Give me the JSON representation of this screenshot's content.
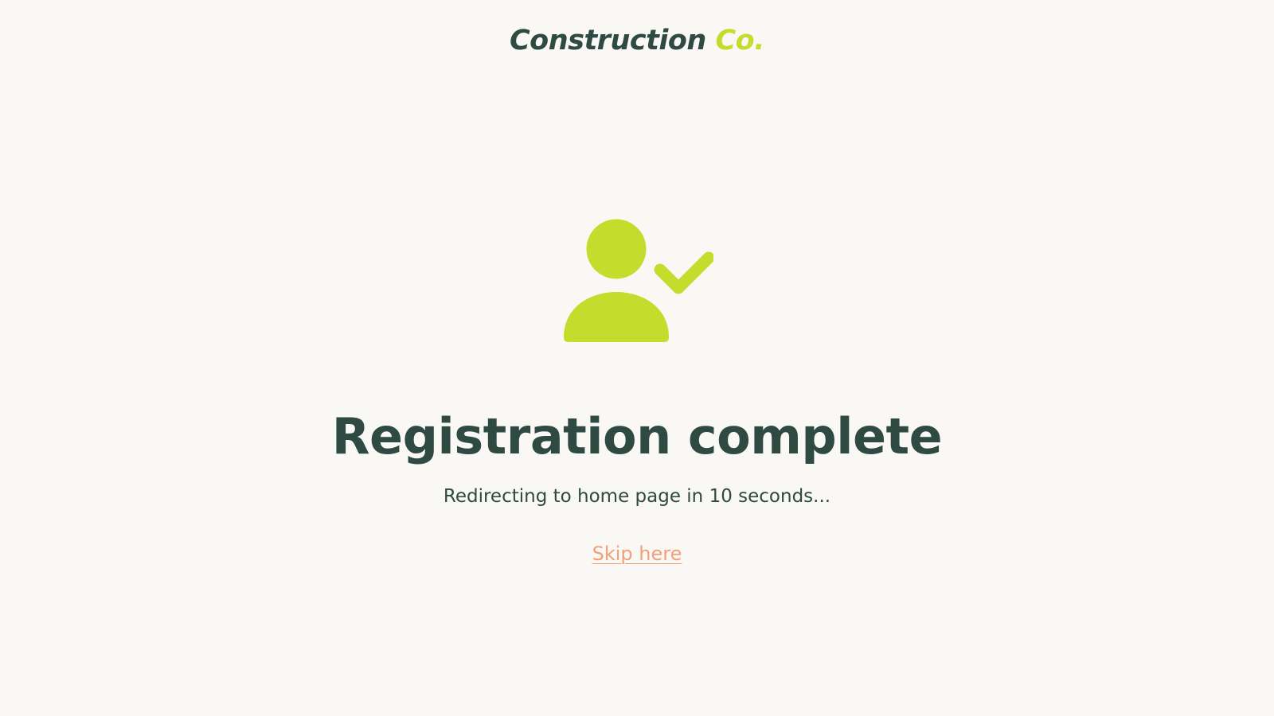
{
  "brand": {
    "name_main": "Construction",
    "name_accent": "Co.",
    "color_dark": "#2f4a43",
    "color_accent": "#c4dc2c"
  },
  "hero": {
    "icon": "user-check-icon",
    "icon_color": "#c4dc2c"
  },
  "status": {
    "title": "Registration complete",
    "message": "Redirecting to home page in 10 seconds..."
  },
  "actions": {
    "skip_label": "Skip here",
    "skip_color": "#f2a07c"
  }
}
